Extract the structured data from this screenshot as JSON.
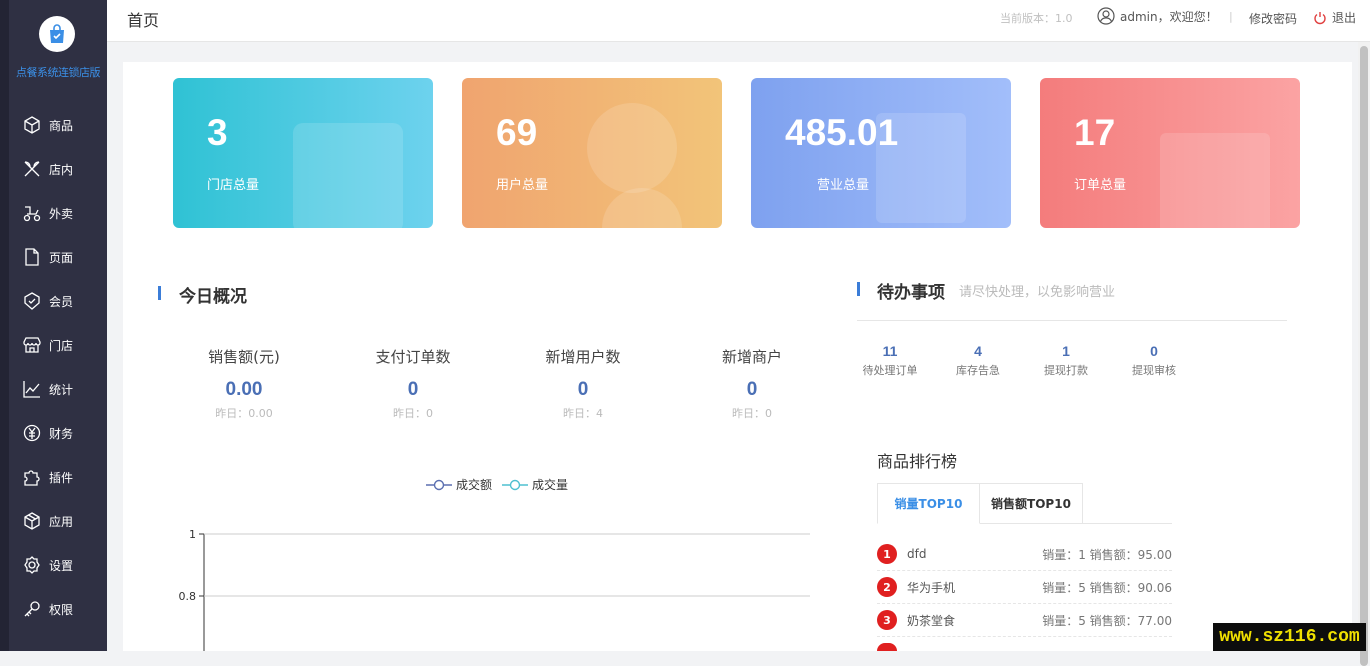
{
  "app": {
    "name": "点餐系统连锁店版"
  },
  "sidebar": {
    "items": [
      {
        "label": "商品",
        "icon": "box-icon"
      },
      {
        "label": "店内",
        "icon": "utensils-icon"
      },
      {
        "label": "外卖",
        "icon": "scooter-icon"
      },
      {
        "label": "页面",
        "icon": "page-icon"
      },
      {
        "label": "会员",
        "icon": "member-icon"
      },
      {
        "label": "门店",
        "icon": "store-icon"
      },
      {
        "label": "统计",
        "icon": "chart-icon"
      },
      {
        "label": "财务",
        "icon": "yen-icon"
      },
      {
        "label": "插件",
        "icon": "puzzle-icon"
      },
      {
        "label": "应用",
        "icon": "cube-icon"
      },
      {
        "label": "设置",
        "icon": "gear-icon"
      },
      {
        "label": "权限",
        "icon": "key-icon"
      }
    ]
  },
  "header": {
    "title": "首页",
    "version": "当前版本：1.0",
    "user": "admin，欢迎您！",
    "separator": "|",
    "change_password": "修改密码",
    "logout": "退出"
  },
  "cards": [
    {
      "value": "3",
      "label": "门店总量",
      "color": "#2fc2d4"
    },
    {
      "value": "69",
      "label": "用户总量",
      "color": "#f0a46f"
    },
    {
      "value": "485.01",
      "label": "营业总量",
      "color": "#88aaf5"
    },
    {
      "value": "17",
      "label": "订单总量",
      "color": "#f47c7c"
    }
  ],
  "today": {
    "title": "今日概况",
    "stats": [
      {
        "label": "销售额(元)",
        "value": "0.00",
        "sub": "昨日：0.00"
      },
      {
        "label": "支付订单数",
        "value": "0",
        "sub": "昨日：0"
      },
      {
        "label": "新增用户数",
        "value": "0",
        "sub": "昨日：4"
      },
      {
        "label": "新增商户",
        "value": "0",
        "sub": "昨日：0"
      }
    ],
    "legend": [
      "成交额",
      "成交量"
    ],
    "chart_data": {
      "type": "line",
      "series": [
        {
          "name": "成交额",
          "values": []
        },
        {
          "name": "成交量",
          "values": []
        }
      ],
      "yticks": [
        "1",
        "0.8"
      ],
      "ylim": [
        0,
        1
      ],
      "grid": true,
      "legend_position": "top"
    }
  },
  "todo": {
    "title": "待办事项",
    "subtitle": "请尽快处理，以免影响营业",
    "items": [
      {
        "value": "11",
        "label": "待处理订单"
      },
      {
        "value": "4",
        "label": "库存告急"
      },
      {
        "value": "1",
        "label": "提现打款"
      },
      {
        "value": "0",
        "label": "提现审核"
      }
    ]
  },
  "ranking": {
    "title": "商品排行榜",
    "tabs": [
      "销量TOP10",
      "销售额TOP10"
    ],
    "rows": [
      {
        "rank": "1",
        "name": "dfd",
        "meta": "销量：1 销售额：95.00"
      },
      {
        "rank": "2",
        "name": "华为手机",
        "meta": "销量：5 销售额：90.06"
      },
      {
        "rank": "3",
        "name": "奶茶堂食",
        "meta": "销量：5 销售额：77.00"
      }
    ]
  },
  "watermark": "www.sz116.com"
}
